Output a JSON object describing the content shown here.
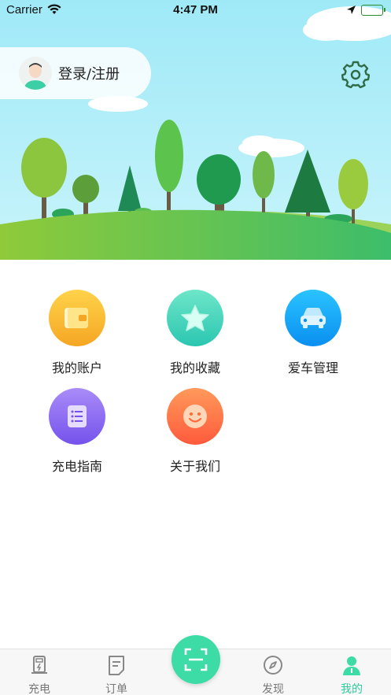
{
  "status_bar": {
    "carrier": "Carrier",
    "time": "4:47 PM"
  },
  "profile": {
    "login_label": "登录/注册"
  },
  "menu": {
    "items": [
      {
        "label": "我的账户",
        "icon": "wallet-icon",
        "color": "#f8b91f"
      },
      {
        "label": "我的收藏",
        "icon": "star-icon",
        "color": "#3fd6b8"
      },
      {
        "label": "爱车管理",
        "icon": "car-icon",
        "color": "#1aa3f5"
      },
      {
        "label": "充电指南",
        "icon": "list-icon",
        "color": "#8a6cf2"
      },
      {
        "label": "关于我们",
        "icon": "smile-icon",
        "color": "#ff6f47"
      }
    ]
  },
  "tabbar": {
    "tabs": [
      {
        "label": "充电",
        "icon": "charger-icon"
      },
      {
        "label": "订单",
        "icon": "order-icon"
      },
      {
        "label": "发现",
        "icon": "compass-icon"
      },
      {
        "label": "我的",
        "icon": "person-icon",
        "active": true
      }
    ],
    "scan_icon": "scan-icon",
    "accent": "#2ecc9a"
  }
}
